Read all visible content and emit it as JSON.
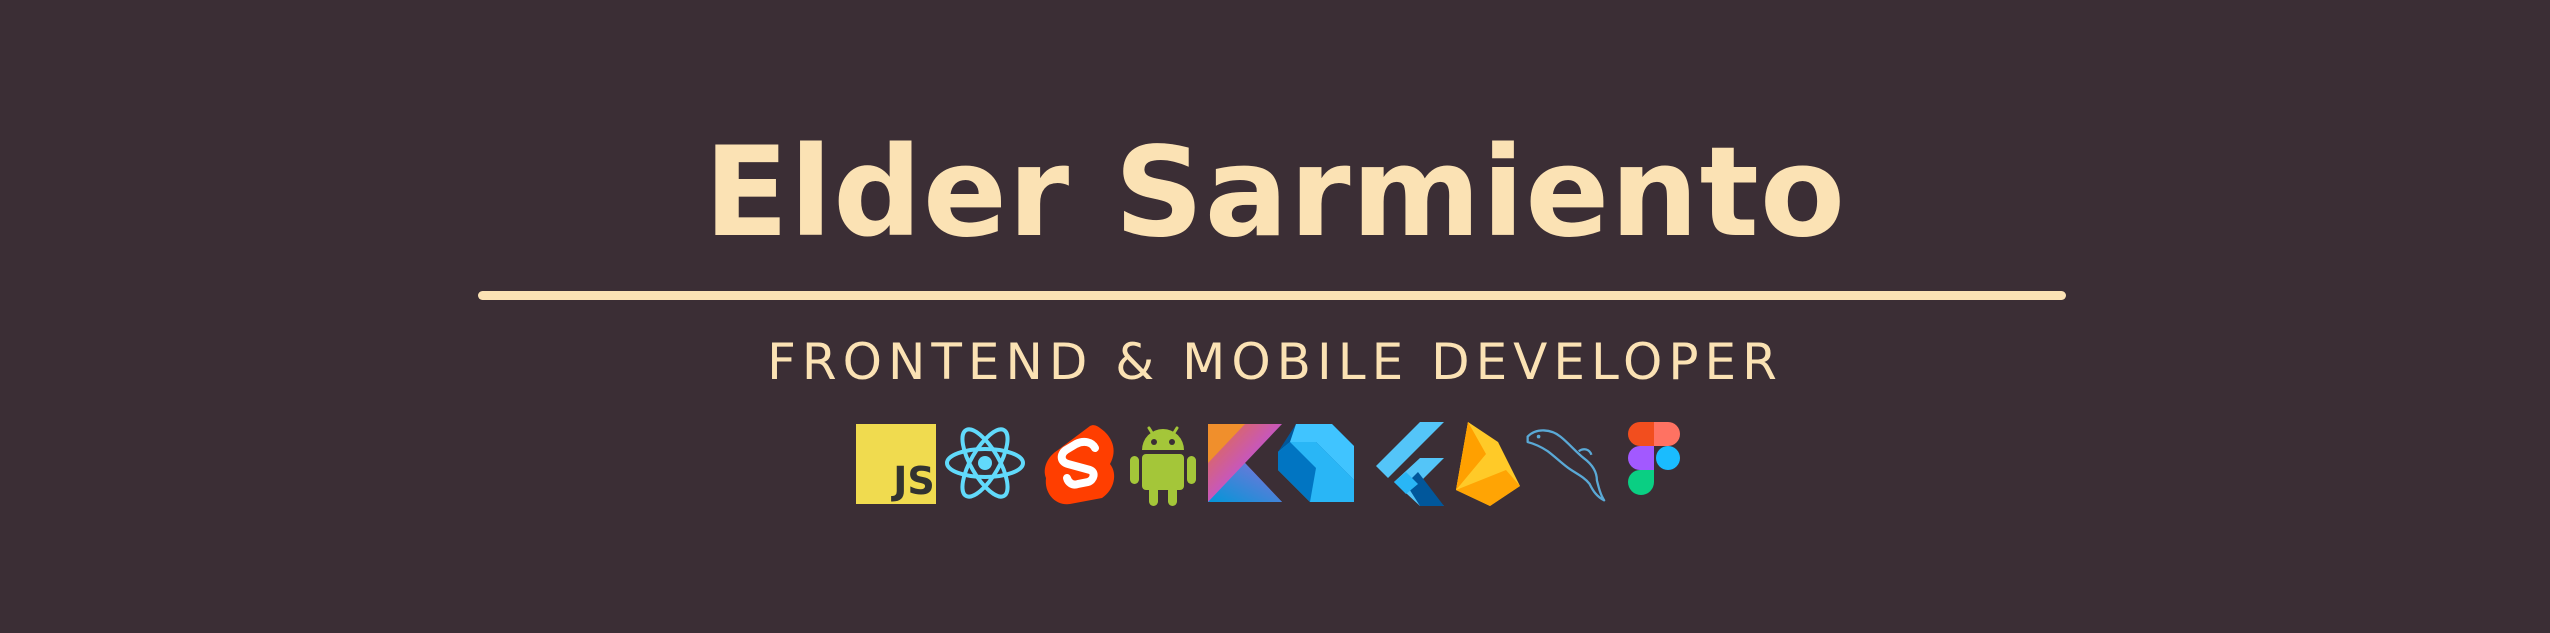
{
  "banner": {
    "title": "Elder Sarmiento",
    "subtitle": "FRONTEND & MOBILE DEVELOPER",
    "background_color": "#3b2e35",
    "accent_color": "#fbe2b4"
  },
  "tech_icons": [
    {
      "icon": "javascript-icon",
      "label": "JS"
    },
    {
      "icon": "react-icon"
    },
    {
      "icon": "svelte-icon"
    },
    {
      "icon": "android-icon"
    },
    {
      "icon": "kotlin-icon"
    },
    {
      "icon": "dart-icon"
    },
    {
      "icon": "flutter-icon"
    },
    {
      "icon": "firebase-icon"
    },
    {
      "icon": "mysql-icon"
    },
    {
      "icon": "figma-icon"
    }
  ]
}
